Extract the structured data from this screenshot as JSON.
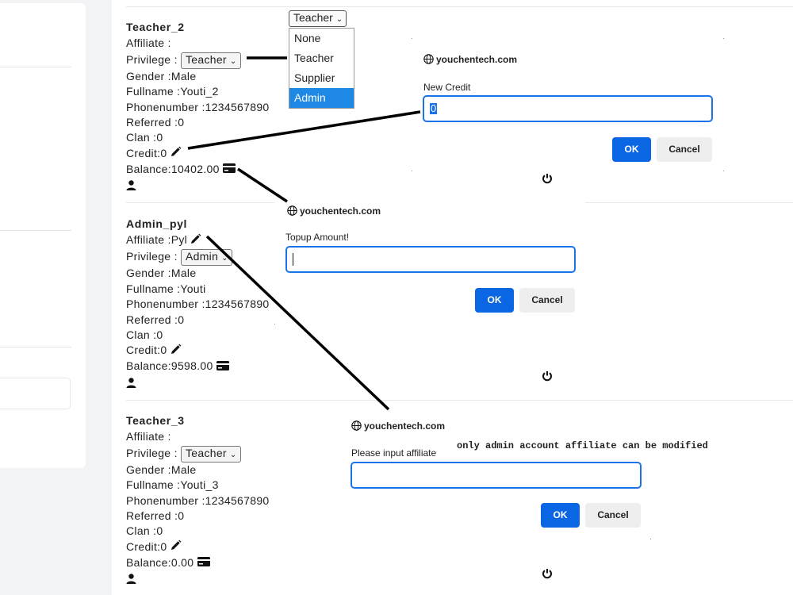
{
  "users": [
    {
      "username": "Teacher_2",
      "affiliate": "Affiliate :",
      "privilege_label": "Privilege :",
      "privilege_value": "Teacher",
      "gender": "Gender :Male",
      "fullname": "Fullname :Youti_2",
      "phonenumber": "Phonenumber :1234567890",
      "referred": "Referred :0",
      "clan": "Clan :0",
      "credit": "Credit:0",
      "balance": "Balance:10402.00"
    },
    {
      "username": "Admin_pyl",
      "affiliate": "Affiliate :Pyl",
      "privilege_label": "Privilege :",
      "privilege_value": "Admin",
      "gender": "Gender :Male",
      "fullname": "Fullname :Youti",
      "phonenumber": "Phonenumber :1234567890",
      "referred": "Referred :0",
      "clan": "Clan :0",
      "credit": "Credit:0",
      "balance": "Balance:9598.00"
    },
    {
      "username": "Teacher_3",
      "affiliate": "Affiliate :",
      "privilege_label": "Privilege :",
      "privilege_value": "Teacher",
      "gender": "Gender :Male",
      "fullname": "Fullname :Youti_3",
      "phonenumber": "Phonenumber :1234567890",
      "referred": "Referred :0",
      "clan": "Clan :0",
      "credit": "Credit:0",
      "balance": "Balance:0.00"
    }
  ],
  "privilege_dropdown": {
    "selected": "Teacher",
    "options": [
      "None",
      "Teacher",
      "Supplier",
      "Admin"
    ],
    "highlighted": "Admin"
  },
  "dialogs": {
    "credit": {
      "site": "youchentech.com",
      "label": "New Credit",
      "value": "0",
      "ok": "OK",
      "cancel": "Cancel"
    },
    "topup": {
      "site": "youchentech.com",
      "label": "Topup Amount!",
      "value": "",
      "ok": "OK",
      "cancel": "Cancel"
    },
    "affiliate": {
      "site": "youchentech.com",
      "label": "Please input affiliate",
      "value": "",
      "ok": "OK",
      "cancel": "Cancel",
      "note": "only admin account affiliate can be modified"
    }
  },
  "icons": {
    "edit": "pencil-icon",
    "balance": "credit-card-icon",
    "profile": "user-icon",
    "logout": "power-icon",
    "site": "globe-icon"
  },
  "colors": {
    "accent": "#0b66e4",
    "input_border": "#1a73e8",
    "highlight": "#1e88e5",
    "annotation": "#000000"
  }
}
